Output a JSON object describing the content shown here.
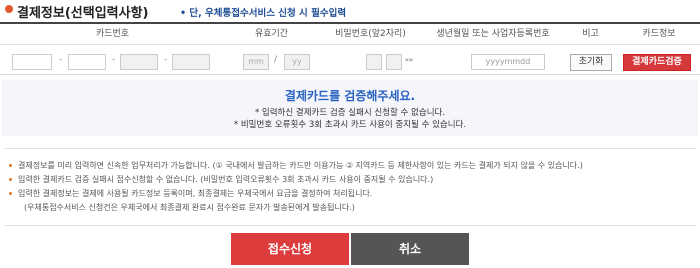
{
  "header": {
    "title": "결제정보(선택입력사항)",
    "note": "• 단, 우체통접수서비스 신청 시 필수입력"
  },
  "table": {
    "headers": [
      "카드번호",
      "유효기간",
      "비밀번호(앞2자리)",
      "생년월일 또는 사업자등록번호",
      "비고",
      "카드정보"
    ],
    "expiry_month_placeholder": "mm",
    "expiry_year_placeholder": "yy",
    "password_suffix": "**",
    "birth_placeholder": "yyyymmdd",
    "reset_button": "초기화",
    "verify_button": "결제카드검증"
  },
  "verify_box": {
    "title": "결제카드를 검증해주세요.",
    "lines": [
      "* 입력하신 결제카드 검증 실패시 신청할 수 없습니다.",
      "* 비밀번호 오류횟수 3회 초과시 카드 사용이 중지될 수 있습니다."
    ]
  },
  "notes": [
    "결제정보를 미리 입력하면 신속한 업무처리가 가능합니다. (① 국내에서 발급하는 카드만 이용가능 ② 지역카드 등 제한사항이 있는 카드는 결제가 되지 않을 수 있습니다.)",
    "입력한 결제카드 검증 실패시 접수신청할 수 없습니다. (비밀번호 입력오류횟수 3회 초과시 카드 사용이 중지될 수 있습니다.)",
    "입력한 결제정보는 결제에 사용될 카드정보 등록이며, 최종결제는 우체국에서 요금을 결정하여 처리됩니다.",
    "(우체통접수서비스 신청건은 우체국에서 최종결제 완료시 접수완료 문자가 발송된에게 발송됩니다.)"
  ],
  "actions": {
    "submit": "접수신청",
    "cancel": "취소"
  },
  "colors": {
    "accent_red": "#dc3c3c",
    "accent_blue": "#2a63c0",
    "dark_grey": "#555555"
  }
}
